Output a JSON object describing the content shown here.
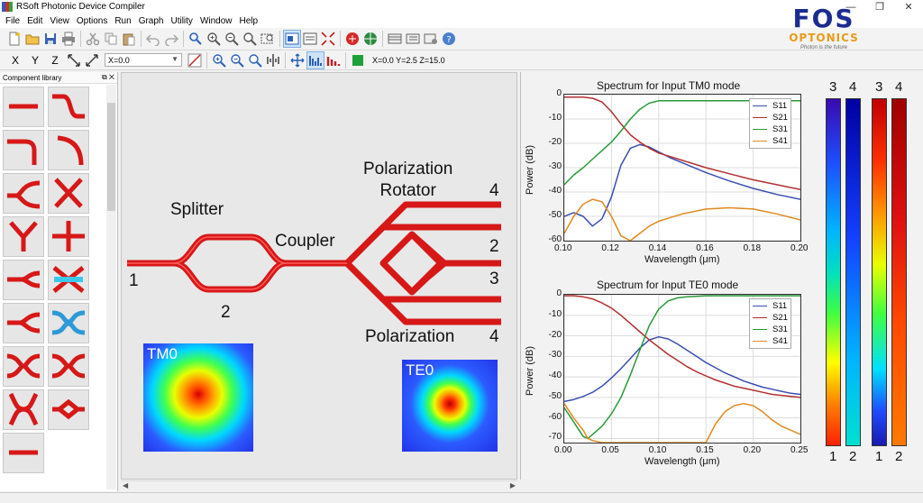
{
  "app": {
    "title": "RSoft Photonic Device Compiler"
  },
  "menu": [
    "File",
    "Edit",
    "View",
    "Options",
    "Run",
    "Graph",
    "Utility",
    "Window",
    "Help"
  ],
  "toolbar2": {
    "axes": [
      "X",
      "Y",
      "Z"
    ],
    "coord_value": "X=0.0",
    "position_readout": "X=0.0  Y=2.5  Z=15.0"
  },
  "library": {
    "title": "Component library",
    "components": [
      "straight-waveguide",
      "s-bend",
      "bend-right",
      "arc-bend",
      "y-branch",
      "crossing",
      "y-splitter",
      "t-junction",
      "taper-y",
      "mmi-crossing",
      "y-junction",
      "directional-coupler",
      "x-coupler",
      "double-coupler",
      "x-branch",
      "ring-diamond",
      "straight-short"
    ]
  },
  "logo": {
    "title": "FOS",
    "subtitle": "OPTONICS",
    "tagline": "Photon is the future"
  },
  "diagram": {
    "labels": {
      "splitter": "Splitter",
      "coupler": "Coupler",
      "pol_rotator": "Polarization\nRotator",
      "polarization": "Polarization",
      "port1": "1",
      "port2_bottom": "2",
      "port4_top": "4",
      "port2_right": "2",
      "port3_right": "3",
      "port4_bottom": "4"
    },
    "modes": [
      {
        "label": "TM0"
      },
      {
        "label": "TE0"
      }
    ]
  },
  "chart_data": [
    {
      "type": "line",
      "title": "Spectrum for Input TM0 mode",
      "xlabel": "Wavelength (μm)",
      "ylabel": "Power (dB)",
      "xlim": [
        0.1,
        0.2
      ],
      "ylim": [
        -60,
        0
      ],
      "xticks": [
        "0.10",
        "0.12",
        "0.14",
        "0.16",
        "0.18",
        "0.20"
      ],
      "yticks": [
        "0",
        "-10",
        "-20",
        "-30",
        "-40",
        "-50",
        "-60"
      ],
      "x": [
        0.1,
        0.104,
        0.108,
        0.112,
        0.116,
        0.12,
        0.124,
        0.128,
        0.132,
        0.136,
        0.14,
        0.145,
        0.15,
        0.16,
        0.17,
        0.18,
        0.19,
        0.2
      ],
      "series": [
        {
          "name": "S11",
          "color": "#3a4fb0",
          "values": [
            -50,
            -48.5,
            -50,
            -54,
            -51,
            -42,
            -29,
            -22,
            -20.5,
            -21.5,
            -23.5,
            -26,
            -28,
            -32,
            -35.5,
            -38.5,
            -41,
            -43
          ]
        },
        {
          "name": "S21",
          "color": "#b23030",
          "values": [
            -1,
            -1,
            -1,
            -1.5,
            -3,
            -7,
            -12,
            -16.5,
            -19.5,
            -22,
            -24,
            -25.5,
            -27,
            -30,
            -32.5,
            -35,
            -37,
            -39
          ]
        },
        {
          "name": "S31",
          "color": "#2a9a3a",
          "values": [
            -37,
            -33,
            -30,
            -26.5,
            -23,
            -19.5,
            -15,
            -10,
            -6,
            -3.5,
            -2.5,
            -2.5,
            -2.5,
            -2.5,
            -2.5,
            -2.5,
            -2.5,
            -2.5
          ]
        },
        {
          "name": "S41",
          "color": "#e08a1e",
          "values": [
            -57,
            -50,
            -45,
            -43,
            -44,
            -50,
            -58,
            -60,
            -57,
            -54,
            -52,
            -50.5,
            -49,
            -47,
            -46.5,
            -47,
            -49,
            -51.5
          ]
        }
      ],
      "legend": "top-right",
      "grid": true
    },
    {
      "type": "line",
      "title": "Spectrum for Input TE0 mode",
      "xlabel": "Wavelength (μm)",
      "ylabel": "Power (dB)",
      "xlim": [
        0.0,
        0.25
      ],
      "ylim": [
        -72,
        0
      ],
      "xticks": [
        "0.00",
        "0.05",
        "0.10",
        "0.15",
        "0.20",
        "0.25"
      ],
      "yticks": [
        "0",
        "-10",
        "-20",
        "-30",
        "-40",
        "-50",
        "-60",
        "-70"
      ],
      "x": [
        0.0,
        0.01,
        0.02,
        0.025,
        0.03,
        0.04,
        0.05,
        0.06,
        0.07,
        0.08,
        0.09,
        0.1,
        0.11,
        0.12,
        0.13,
        0.14,
        0.15,
        0.16,
        0.17,
        0.18,
        0.19,
        0.2,
        0.21,
        0.22,
        0.23,
        0.24,
        0.25
      ],
      "series": [
        {
          "name": "S11",
          "color": "#3a4fb0",
          "values": [
            -52,
            -51,
            -49.5,
            -48.5,
            -47.5,
            -44.5,
            -40.5,
            -36,
            -31,
            -26,
            -22,
            -20.5,
            -21.5,
            -24,
            -27,
            -30,
            -33,
            -35.5,
            -38,
            -40,
            -42,
            -43.5,
            -45,
            -46,
            -47,
            -48,
            -48.5
          ]
        },
        {
          "name": "S21",
          "color": "#b23030",
          "values": [
            -0.5,
            -0.5,
            -1,
            -1.5,
            -2,
            -4,
            -6.5,
            -10,
            -14,
            -18,
            -22,
            -25.5,
            -29,
            -32,
            -35,
            -37.5,
            -39.5,
            -41.5,
            -43,
            -44.5,
            -45.5,
            -46.5,
            -47.5,
            -48.5,
            -49,
            -49.5,
            -50
          ]
        },
        {
          "name": "S31",
          "color": "#2a9a3a",
          "values": [
            -55,
            -62,
            -69,
            -70,
            -68,
            -64,
            -58,
            -50,
            -39,
            -27,
            -15,
            -7,
            -3,
            -1.5,
            -1,
            -0.8,
            -0.5,
            -0.5,
            -0.5,
            -0.5,
            -0.5,
            -0.5,
            -0.5,
            -0.5,
            -0.5,
            -0.5,
            -0.5
          ]
        },
        {
          "name": "S41",
          "color": "#e08a1e",
          "values": [
            -53,
            -60,
            -66,
            -70,
            -71,
            -72,
            -72,
            -72,
            -72,
            -72,
            -72,
            -72,
            -72,
            -72,
            -72,
            -72,
            -72,
            -63,
            -57,
            -54,
            -53,
            -54,
            -57,
            -61,
            -64,
            -66,
            -68
          ]
        }
      ],
      "legend": "top-right",
      "grid": true
    }
  ],
  "colorbars": {
    "labels_top": [
      "3",
      "4",
      "3",
      "4"
    ],
    "labels_bottom": [
      "1",
      "2",
      "1",
      "2"
    ]
  }
}
